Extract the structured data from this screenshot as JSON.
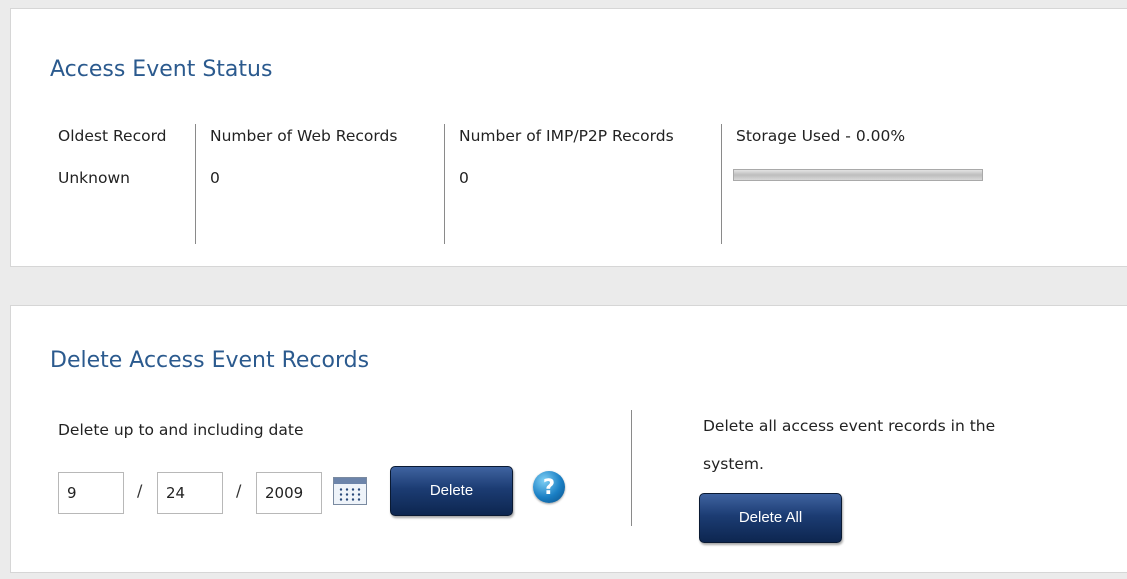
{
  "status": {
    "title": "Access Event Status",
    "columns": [
      {
        "label": "Oldest Record",
        "value": "Unknown"
      },
      {
        "label": "Number of Web Records",
        "value": "0"
      },
      {
        "label": "Number of IMP/P2P Records",
        "value": "0"
      },
      {
        "label": "Storage Used - 0.00%"
      }
    ],
    "storage_used_fraction": 0.0
  },
  "delete": {
    "title": "Delete Access Event Records",
    "date_label": "Delete up to and including date",
    "month": "9",
    "day": "24",
    "year": "2009",
    "date_separator": "/",
    "calendar_icon": "calendar-icon",
    "delete_button": "Delete",
    "help_icon": "?",
    "delete_all_text_line1": "Delete all access event records in the",
    "delete_all_text_line2": "system.",
    "delete_all_button": "Delete All"
  },
  "colors": {
    "title": "#2b5a8e",
    "button": "#1c3c73",
    "page_bg": "#ebebeb"
  }
}
